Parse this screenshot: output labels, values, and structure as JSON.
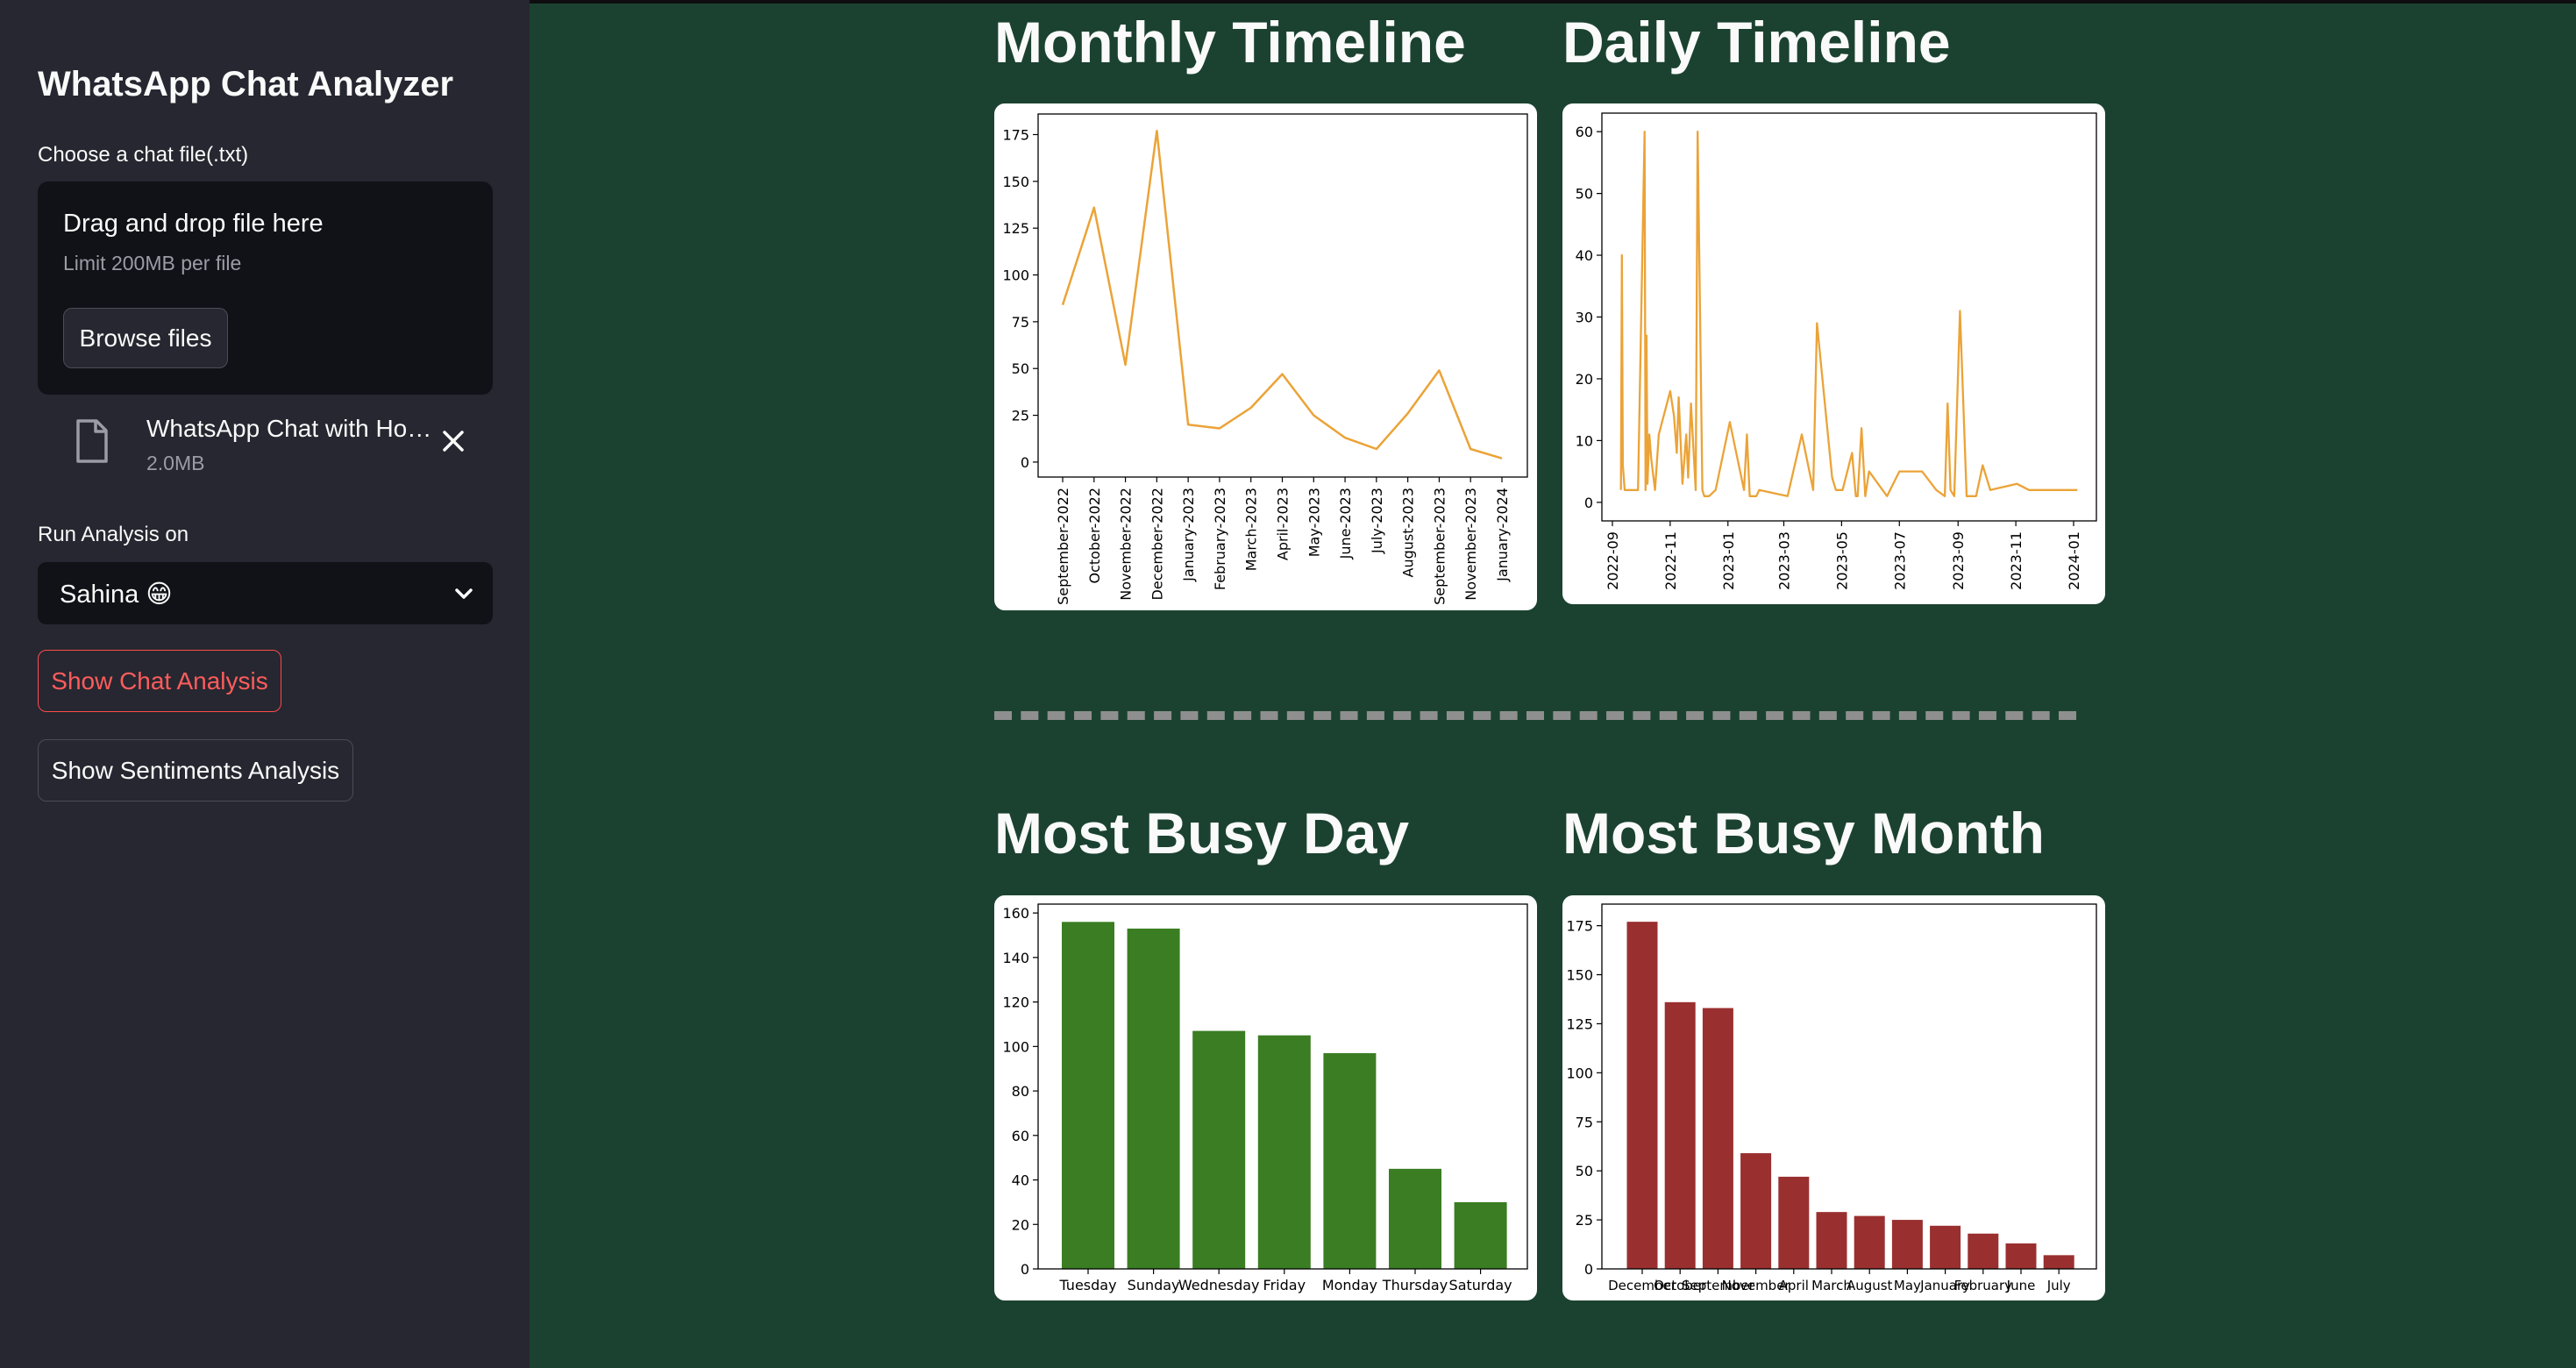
{
  "sidebar": {
    "app_title": "WhatsApp Chat Analyzer",
    "upload_label": "Choose a chat file(.txt)",
    "drop_title": "Drag and drop file here",
    "drop_limit": "Limit 200MB per file",
    "browse_label": "Browse files",
    "file_name": "WhatsApp Chat with Ho…",
    "file_size": "2.0MB",
    "file_icon": "file-icon",
    "close_icon": "close-icon",
    "run_label": "Run Analysis on",
    "selected_user": "Sahina 😁",
    "chat_button": "Show Chat Analysis",
    "sentiment_button": "Show Sentiments Analysis"
  },
  "main": {
    "monthly_title": "Monthly Timeline",
    "daily_title": "Daily Timeline",
    "busy_day_title": "Most Busy Day",
    "busy_month_title": "Most Busy Month"
  },
  "colors": {
    "line": "#eba338",
    "busy_day_bar": "#3a7d22",
    "busy_month_bar": "#9a2f2f",
    "accent_button": "#ff4b4b"
  },
  "chart_data": [
    {
      "id": "monthly",
      "type": "line",
      "categories": [
        "September-2022",
        "October-2022",
        "November-2022",
        "December-2022",
        "January-2023",
        "February-2023",
        "March-2023",
        "April-2023",
        "May-2023",
        "June-2023",
        "July-2023",
        "August-2023",
        "September-2023",
        "November-2023",
        "January-2024"
      ],
      "values": [
        84,
        136,
        52,
        177,
        20,
        18,
        29,
        47,
        25,
        13,
        7,
        26,
        49,
        7,
        2
      ],
      "ylim": [
        -8,
        186
      ],
      "yticks": [
        0,
        25,
        50,
        75,
        100,
        125,
        150,
        175
      ]
    },
    {
      "id": "daily",
      "type": "line",
      "x": [
        "2022-09-10",
        "2022-09-11",
        "2022-09-12",
        "2022-09-14",
        "2022-09-28",
        "2022-10-05",
        "2022-10-06",
        "2022-10-07",
        "2022-10-08",
        "2022-10-10",
        "2022-10-12",
        "2022-10-16",
        "2022-10-20",
        "2022-11-01",
        "2022-11-05",
        "2022-11-08",
        "2022-11-10",
        "2022-11-14",
        "2022-11-18",
        "2022-11-20",
        "2022-11-23",
        "2022-11-28",
        "2022-11-30",
        "2022-12-05",
        "2022-12-07",
        "2022-12-09",
        "2022-12-12",
        "2022-12-19",
        "2023-01-03",
        "2023-01-18",
        "2023-01-21",
        "2023-01-24",
        "2023-01-31",
        "2023-02-03",
        "2023-03-05",
        "2023-03-20",
        "2023-04-01",
        "2023-04-05",
        "2023-04-21",
        "2023-04-25",
        "2023-05-02",
        "2023-05-12",
        "2023-05-16",
        "2023-05-18",
        "2023-05-22",
        "2023-05-26",
        "2023-05-30",
        "2023-06-18",
        "2023-07-01",
        "2023-07-25",
        "2023-08-09",
        "2023-08-18",
        "2023-08-21",
        "2023-08-24",
        "2023-08-28",
        "2023-09-03",
        "2023-09-10",
        "2023-09-20",
        "2023-09-27",
        "2023-10-05",
        "2023-11-02",
        "2023-11-15",
        "2023-11-25",
        "2024-01-05"
      ],
      "values": [
        2,
        40,
        6,
        2,
        2,
        60,
        2,
        27,
        3,
        11,
        7,
        2,
        11,
        18,
        14,
        8,
        17,
        3,
        11,
        4,
        16,
        2,
        60,
        2,
        1,
        1,
        1,
        2,
        13,
        2,
        11,
        1,
        1,
        2,
        1,
        11,
        2,
        29,
        4,
        2,
        2,
        8,
        1,
        1,
        12,
        1,
        5,
        1,
        5,
        5,
        2,
        1,
        16,
        2,
        1,
        31,
        1,
        1,
        6,
        2,
        3,
        2,
        2,
        2
      ],
      "xticks": [
        "2022-09",
        "2022-11",
        "2023-01",
        "2023-03",
        "2023-05",
        "2023-07",
        "2023-09",
        "2023-11",
        "2024-01"
      ],
      "ylim": [
        -3,
        63
      ],
      "yticks": [
        0,
        10,
        20,
        30,
        40,
        50,
        60
      ]
    },
    {
      "id": "busy_day",
      "type": "bar",
      "categories": [
        "Tuesday",
        "Sunday",
        "Wednesday",
        "Friday",
        "Monday",
        "Thursday",
        "Saturday"
      ],
      "values": [
        156,
        153,
        107,
        105,
        97,
        45,
        30
      ],
      "ylim": [
        0,
        164
      ],
      "yticks": [
        0,
        20,
        40,
        60,
        80,
        100,
        120,
        140,
        160
      ]
    },
    {
      "id": "busy_month",
      "type": "bar",
      "categories": [
        "December",
        "October",
        "September",
        "November",
        "April",
        "March",
        "August",
        "May",
        "January",
        "February",
        "June",
        "July"
      ],
      "values": [
        177,
        136,
        133,
        59,
        47,
        29,
        27,
        25,
        22,
        18,
        13,
        7
      ],
      "ylim": [
        0,
        186
      ],
      "yticks": [
        0,
        25,
        50,
        75,
        100,
        125,
        150,
        175
      ]
    }
  ]
}
